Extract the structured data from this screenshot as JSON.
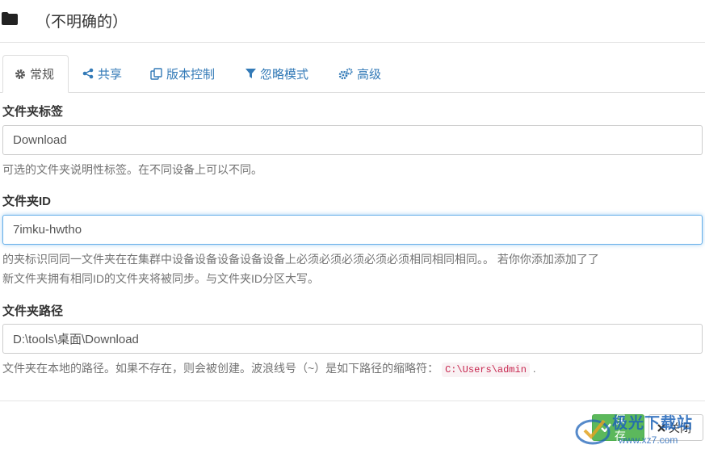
{
  "header": {
    "title": "（不明确的）",
    "folder_icon": "folder-icon"
  },
  "tabs": [
    {
      "label": "常规",
      "icon": "gear-icon",
      "active": true
    },
    {
      "label": "共享",
      "icon": "share-icon"
    },
    {
      "label": "版本控制",
      "icon": "copy-icon"
    },
    {
      "label": "忽略模式",
      "icon": "filter-icon"
    },
    {
      "label": "高级",
      "icon": "gears-icon"
    }
  ],
  "fields": {
    "label": {
      "title": "文件夹标签",
      "value": "Download",
      "help": "可选的文件夹说明性标签。在不同设备上可以不同。"
    },
    "id": {
      "title": "文件夹ID",
      "value": "7imku-hwtho",
      "help_line1": "的夹标识同同一文件夹在在集群中设备设备设备设备设备上必须必须必须必须必须相同相同相同。。 若你你添加添加了了",
      "help_line2": "新文件夹拥有相同ID的文件夹将被同步。与文件夹ID分区大写。"
    },
    "path": {
      "title": "文件夹路径",
      "value": "D:\\tools\\桌面\\Download",
      "help_before": "文件夹在本地的路径。如果不存在，则会被创建。波浪线号（~）是如下路径的缩略符：",
      "help_code": "C:\\Users\\admin",
      "help_after": "."
    }
  },
  "buttons": {
    "save": "保存",
    "close": "关闭"
  },
  "watermark": {
    "text": "极光下载站",
    "url": "www.xz7.com"
  },
  "colors": {
    "link": "#337ab7",
    "save_button": "#5cb85c",
    "code_text": "#c7254e",
    "watermark": "#1d63b8"
  }
}
